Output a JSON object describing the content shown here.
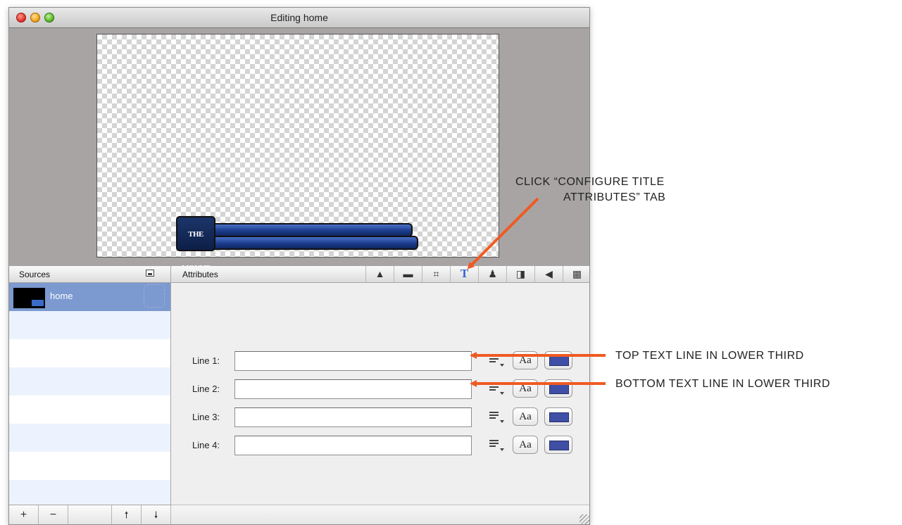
{
  "window": {
    "title": "Editing home"
  },
  "preview": {
    "lower_third_logo_text": "THE MOUNT"
  },
  "sources": {
    "header": "Sources",
    "items": [
      {
        "name": "home",
        "selected": true
      }
    ],
    "footer_buttons": [
      "+",
      "−",
      "🠕",
      "🠗"
    ]
  },
  "attributes": {
    "header": "Attributes",
    "tabs": [
      {
        "icon": "shapes-icon",
        "glyph": "▲",
        "active": false
      },
      {
        "icon": "folder-icon",
        "glyph": "▬",
        "active": false
      },
      {
        "icon": "crop-icon",
        "glyph": "⌗",
        "active": false
      },
      {
        "icon": "title-text-icon",
        "glyph": "T",
        "active": true
      },
      {
        "icon": "person-icon",
        "glyph": "♟",
        "active": false
      },
      {
        "icon": "panel-icon",
        "glyph": "◨",
        "active": false
      },
      {
        "icon": "speaker-icon",
        "glyph": "◀",
        "active": false
      },
      {
        "icon": "chroma-icon",
        "glyph": "▦",
        "active": false
      }
    ],
    "lines": [
      {
        "label": "Line 1:",
        "value": "",
        "font_button": "Aa",
        "color": "#3f4fa6"
      },
      {
        "label": "Line 2:",
        "value": "",
        "font_button": "Aa",
        "color": "#3f4fa6"
      },
      {
        "label": "Line 3:",
        "value": "",
        "font_button": "Aa",
        "color": "#3f4fa6"
      },
      {
        "label": "Line 4:",
        "value": "",
        "font_button": "Aa",
        "color": "#3f4fa6"
      }
    ]
  },
  "annotations": {
    "configure_line1": "CLICK “CONFIGURE TITLE",
    "configure_line2": "ATTRIBUTES” TAB",
    "top_line": "TOP TEXT LINE IN LOWER THIRD",
    "bottom_line": "BOTTOM TEXT LINE IN LOWER THIRD",
    "arrow_color": "#f05a22"
  }
}
